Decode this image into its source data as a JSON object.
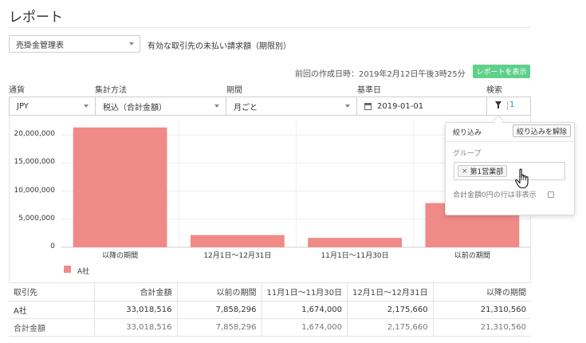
{
  "page": {
    "title": "レポート"
  },
  "report": {
    "selected": "売掛金管理表",
    "description": "有効な取引先の未払い請求額（期限別）",
    "last_created": "前回の作成日時：2019年2月12日午後3時25分",
    "show_button": "レポートを表示"
  },
  "filters": {
    "currency": {
      "label": "通貨",
      "value": "JPY"
    },
    "aggregation": {
      "label": "集計方法",
      "value": "税込（合計金額）"
    },
    "period": {
      "label": "期間",
      "value": "月ごと"
    },
    "base_date": {
      "label": "基準日",
      "value": "2019-01-01"
    },
    "search": {
      "label": "検索",
      "count": "1"
    }
  },
  "filter_popup": {
    "title": "絞り込み",
    "clear_button": "絞り込みを解除",
    "group_label": "グループ",
    "tags": [
      "第1営業部"
    ],
    "tag_remove": "×",
    "hide_zero_label": "合計金額0円の行は非表示",
    "hide_zero_checked": false
  },
  "chart_data": {
    "type": "bar",
    "categories": [
      "以降の期間",
      "12月1日〜12月31日",
      "11月1日〜11月30日",
      "以前の期間"
    ],
    "series": [
      {
        "name": "A社",
        "values": [
          21310560,
          2175660,
          1674000,
          7858296
        ],
        "color": "#ef8a87"
      }
    ],
    "ylim": [
      0,
      22000000
    ],
    "y_ticks": [
      "0",
      "5,000,000",
      "10,000,000",
      "15,000,000",
      "20,000,000"
    ],
    "y_tick_values": [
      0,
      5000000,
      10000000,
      15000000,
      20000000
    ],
    "grid": true,
    "legend": "bottom-left"
  },
  "table": {
    "headers": [
      "取引先",
      "合計金額",
      "以前の期間",
      "11月1日〜11月30日",
      "12月1日〜12月31日",
      "以降の期間"
    ],
    "rows": [
      [
        "A社",
        "33,018,516",
        "7,858,296",
        "1,674,000",
        "2,175,660",
        "21,310,560"
      ]
    ],
    "total": [
      "合計金額",
      "33,018,516",
      "7,858,296",
      "1,674,000",
      "2,175,660",
      "21,310,560"
    ]
  }
}
